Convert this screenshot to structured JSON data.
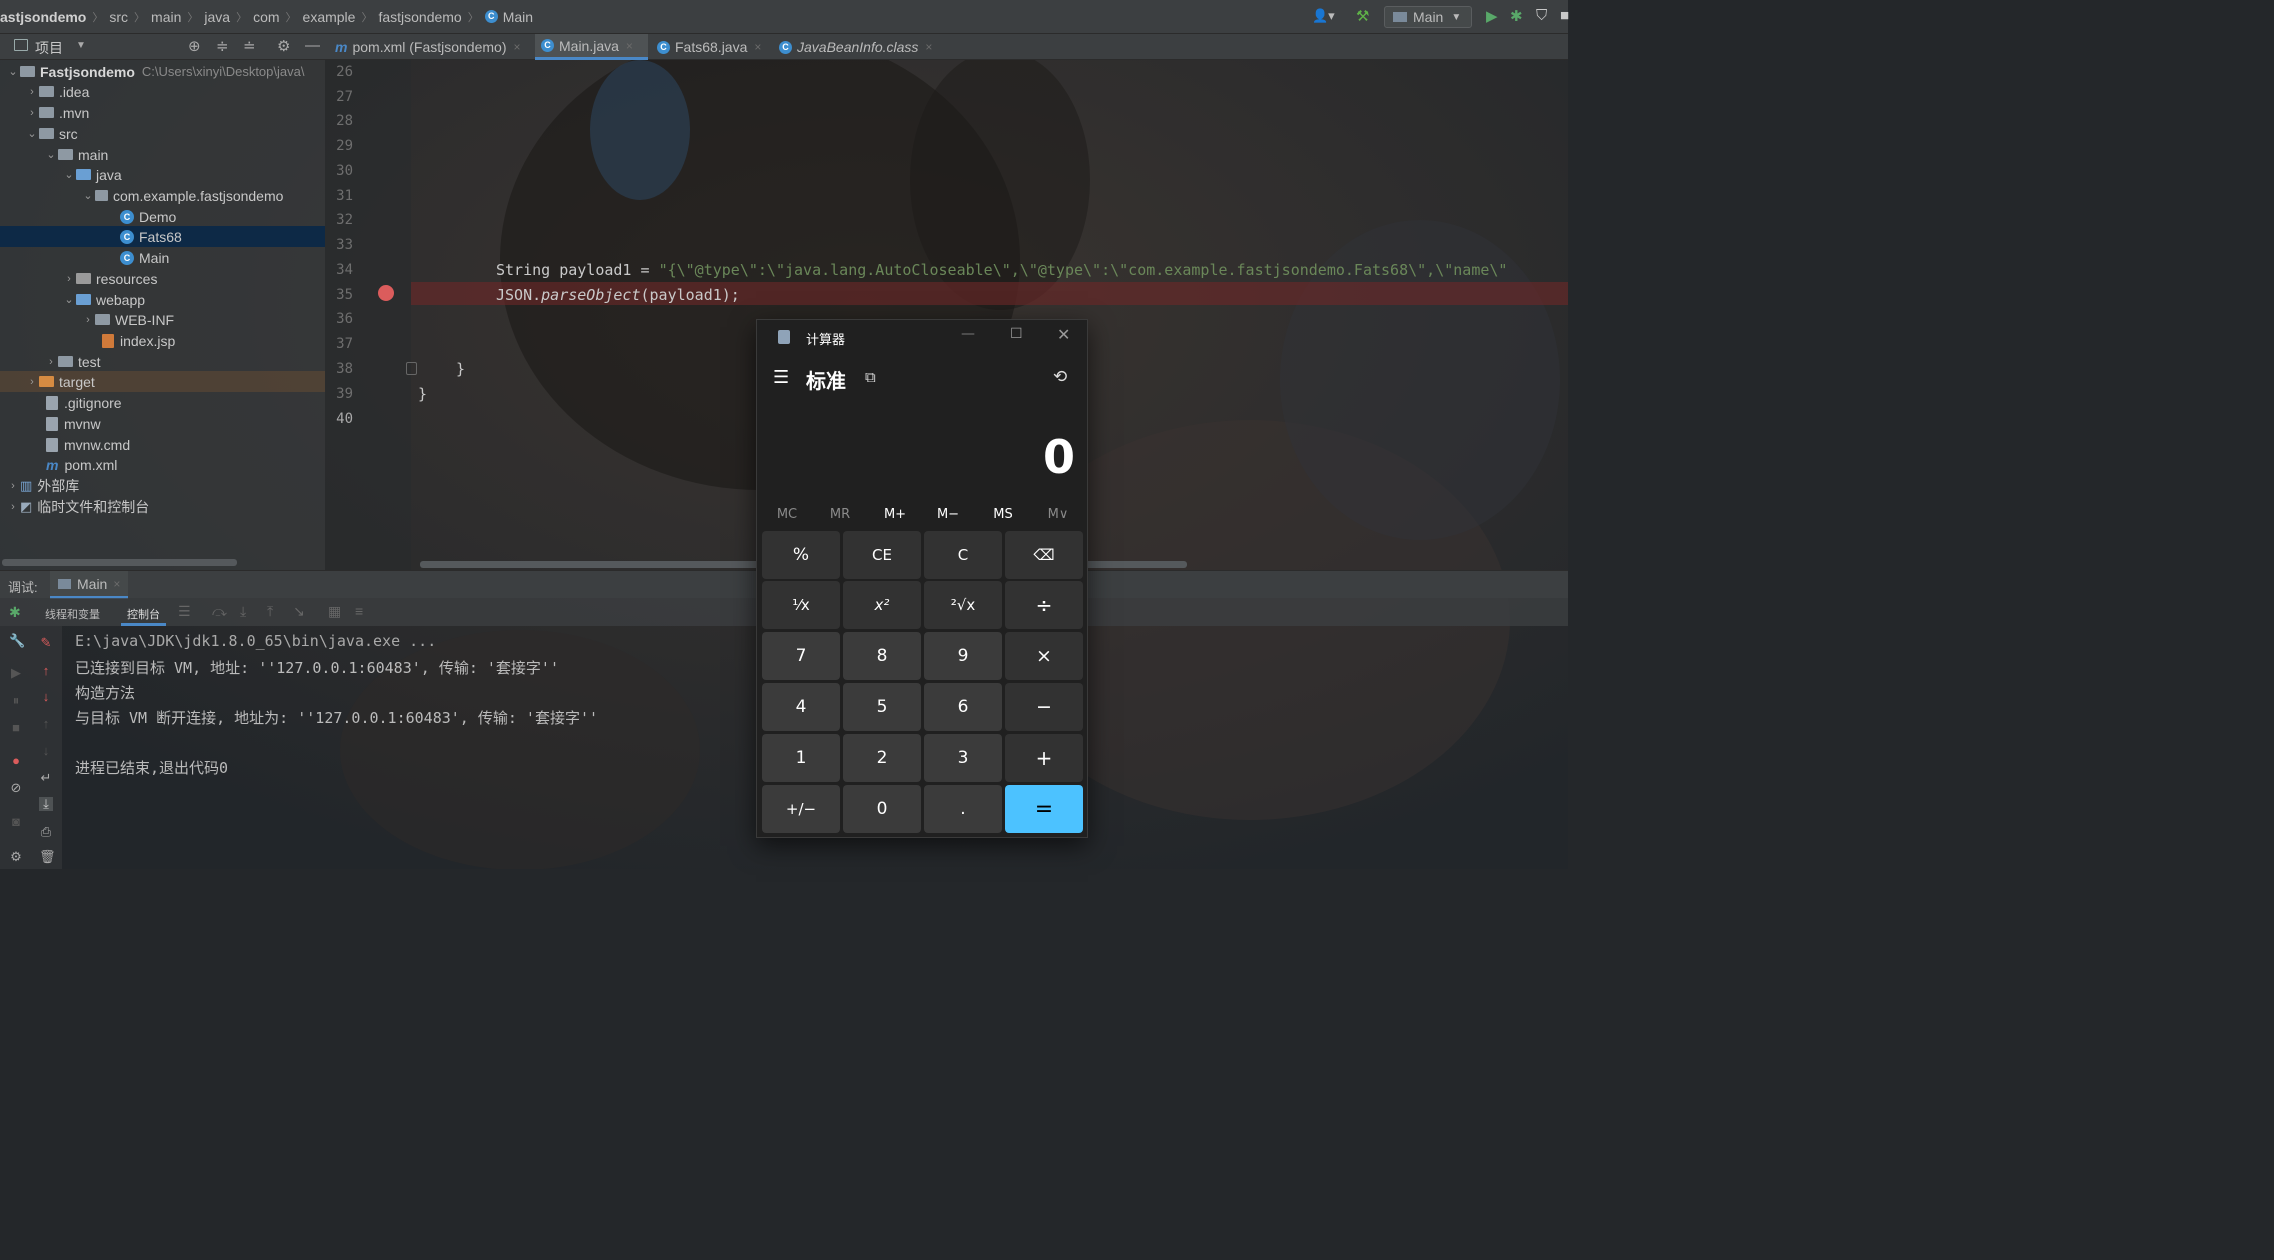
{
  "breadcrumb": [
    "astjsondemo",
    "src",
    "main",
    "java",
    "com",
    "example",
    "fastjsondemo",
    "Main"
  ],
  "run_config": "Main",
  "project_panel": {
    "title": "项目",
    "tree": [
      {
        "label": "Fastjsondemo",
        "path": "C:\\Users\\xinyi\\Desktop\\java\\"
      },
      {
        "label": ".idea"
      },
      {
        "label": ".mvn"
      },
      {
        "label": "src"
      },
      {
        "label": "main"
      },
      {
        "label": "java"
      },
      {
        "label": "com.example.fastjsondemo"
      },
      {
        "label": "Demo"
      },
      {
        "label": "Fats68"
      },
      {
        "label": "Main"
      },
      {
        "label": "resources"
      },
      {
        "label": "webapp"
      },
      {
        "label": "WEB-INF"
      },
      {
        "label": "index.jsp"
      },
      {
        "label": "test"
      },
      {
        "label": "target"
      },
      {
        "label": ".gitignore"
      },
      {
        "label": "mvnw"
      },
      {
        "label": "mvnw.cmd"
      },
      {
        "label": "pom.xml"
      },
      {
        "label": "外部库"
      },
      {
        "label": "临时文件和控制台"
      }
    ]
  },
  "editor_tabs": [
    {
      "label": "pom.xml (Fastjsondemo)"
    },
    {
      "label": "Main.java"
    },
    {
      "label": "Fats68.java"
    },
    {
      "label": "JavaBeanInfo.class"
    }
  ],
  "line_numbers": [
    "26",
    "27",
    "28",
    "29",
    "30",
    "31",
    "32",
    "33",
    "34",
    "35",
    "36",
    "37",
    "38",
    "39",
    "40"
  ],
  "code": {
    "line34_prefix": "String payload1 = ",
    "line34_string": "\"{\\\"@type\\\":\\\"java.lang.AutoCloseable\\\",\\\"@type\\\":\\\"com.example.fastjsondemo.Fats68\\\",\\\"name\\\"",
    "line35_class": "JSON.",
    "line35_method": "parseObject",
    "line35_args": "(payload1);",
    "line38": "}",
    "line39": "}"
  },
  "debug": {
    "label": "调试:",
    "session_tab": "Main",
    "subtab_threads": "线程和变量",
    "subtab_console": "控制台"
  },
  "console_lines": [
    "E:\\java\\JDK\\jdk1.8.0_65\\bin\\java.exe ...",
    "已连接到目标 VM, 地址: ''127.0.0.1:60483', 传输: '套接字''",
    "构造方法",
    "与目标 VM 断开连接, 地址为: ''127.0.0.1:60483', 传输: '套接字''",
    "",
    "进程已结束,退出代码0"
  ],
  "calculator": {
    "title": "计算器",
    "mode": "标准",
    "display": "0",
    "memory": [
      "MC",
      "MR",
      "M+",
      "M−",
      "MS",
      "M∨"
    ],
    "keys": [
      [
        "%",
        "CE",
        "C",
        "⌫"
      ],
      [
        "¹⁄x",
        "x²",
        "²√x",
        "÷"
      ],
      [
        "7",
        "8",
        "9",
        "×"
      ],
      [
        "4",
        "5",
        "6",
        "−"
      ],
      [
        "1",
        "2",
        "3",
        "+"
      ],
      [
        "+/−",
        "0",
        ".",
        "="
      ]
    ]
  },
  "colors": {
    "accent_blue": "#4cc2ff",
    "selection": "#0d2946",
    "breakpoint": "#db5c5c",
    "string": "#6a8759"
  }
}
